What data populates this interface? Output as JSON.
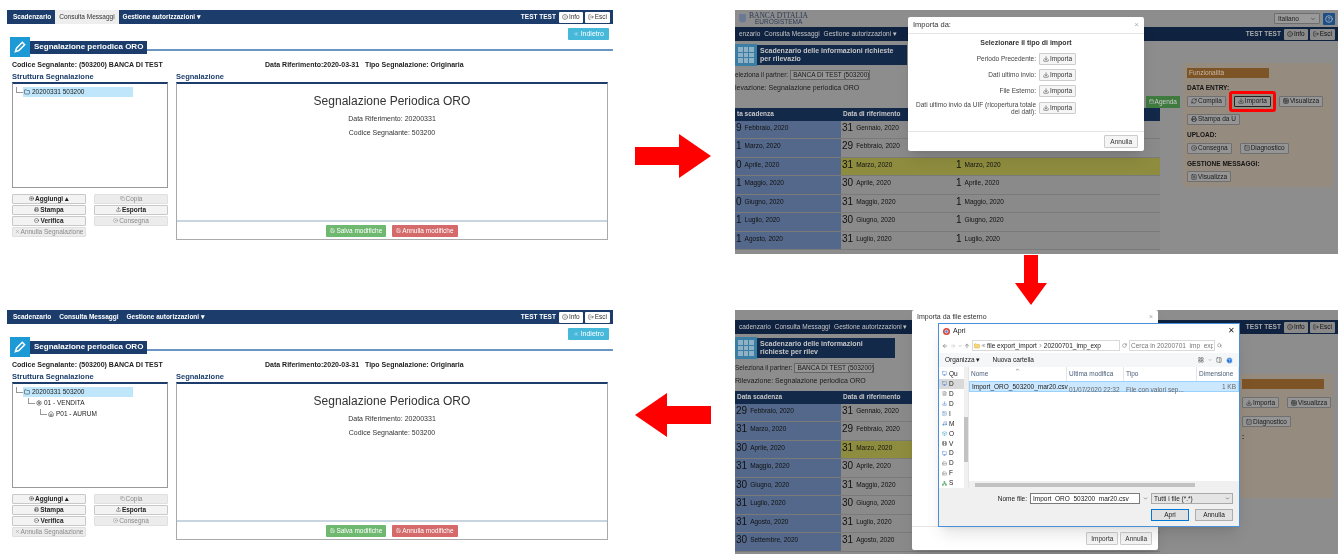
{
  "panels": [
    {
      "kind": "editor",
      "nav": [
        {
          "label": "Scadenzario",
          "selected": false
        },
        {
          "label": "Consulta Messaggi",
          "selected": true
        },
        {
          "label": "Gestione autorizzazioni ▾",
          "selected": false
        }
      ],
      "user": "TEST TEST",
      "info_button": "Info",
      "exit_button": "Esci",
      "back_button": "Indietro",
      "title": "Segnalazione periodica ORO",
      "codice": "Codice Segnalante: (503200) BANCA DI TEST",
      "data_riferimento": "Data Riferimento:2020-03-31",
      "tipo": "Tipo Segnalazione: Originaria",
      "tree_heading": "Struttura Segnalazione",
      "tree": [
        {
          "label": "20200331 503200",
          "selected": true
        }
      ],
      "actions": [
        {
          "label": "Aggiungi ▴",
          "disabled": false
        },
        {
          "label": "Copia",
          "disabled": true
        },
        {
          "label": "Stampa",
          "disabled": false
        },
        {
          "label": "Esporta",
          "disabled": false
        },
        {
          "label": "Verifica",
          "disabled": false
        },
        {
          "label": "Consegna",
          "disabled": true
        },
        {
          "label": "Annulla Segnalazione",
          "disabled": true
        }
      ],
      "section_heading": "Segnalazione",
      "document": {
        "title": "Segnalazione Periodica ORO",
        "lines": [
          "Data Riferimento: 20200331",
          "Codice Segnalante: 503200"
        ]
      },
      "save_button": "Salva modifiche",
      "cancel_button": "Annulla modifiche"
    },
    {
      "kind": "import_choice",
      "logo": {
        "name": "BANCA D'ITALIA",
        "tagline": "EUROSISTEMA"
      },
      "language": "Italiano",
      "nav": [
        {
          "label": "enzario",
          "selected": false
        },
        {
          "label": "Consulta Messaggi",
          "selected": false
        },
        {
          "label": "Gestione autorizzazioni ▾",
          "selected": false
        }
      ],
      "user": "TEST TEST",
      "info_button": "Info",
      "exit_button": "Esci",
      "title": "Scadenzario delle informazioni richieste per rilevazio",
      "partner_label": "eleziona il partner:",
      "partner": "BANCA DI TEST (503200)",
      "rilevazione": "levazione: Segnalazione periodica ORO",
      "agenda_button": "Agenda",
      "columns": [
        "ta scadenza",
        "Data di riferimento"
      ],
      "rows": [
        {
          "selected": false,
          "cells": [
            {
              "day": "9",
              "month": "Febbraio, 2020"
            },
            {
              "day": "31",
              "month": "Gennaio, 2020"
            }
          ]
        },
        {
          "selected": false,
          "cells": [
            {
              "day": "1",
              "month": "Marzo, 2020"
            },
            {
              "day": "29",
              "month": "Febbraio, 2020"
            }
          ]
        },
        {
          "selected": true,
          "cells": [
            {
              "day": "0",
              "month": "Aprile, 2020"
            },
            {
              "day": "31",
              "month": "Marzo, 2020"
            },
            {
              "day": "1",
              "month": "Marzo, 2020"
            }
          ]
        },
        {
          "selected": false,
          "cells": [
            {
              "day": "1",
              "month": "Maggio, 2020"
            },
            {
              "day": "30",
              "month": "Aprile, 2020"
            },
            {
              "day": "1",
              "month": "Aprile, 2020"
            }
          ]
        },
        {
          "selected": false,
          "cells": [
            {
              "day": "0",
              "month": "Giugno, 2020"
            },
            {
              "day": "31",
              "month": "Maggio, 2020"
            },
            {
              "day": "1",
              "month": "Maggio, 2020"
            }
          ]
        },
        {
          "selected": false,
          "cells": [
            {
              "day": "1",
              "month": "Luglio, 2020"
            },
            {
              "day": "30",
              "month": "Giugno, 2020"
            },
            {
              "day": "1",
              "month": "Giugno, 2020"
            }
          ]
        },
        {
          "selected": false,
          "cells": [
            {
              "day": "1",
              "month": "Agosto, 2020"
            },
            {
              "day": "31",
              "month": "Luglio, 2020"
            },
            {
              "day": "1",
              "month": "Luglio, 2020"
            }
          ]
        }
      ],
      "functions": {
        "title": "Funzionalità",
        "groups": [
          {
            "heading": "DATA ENTRY:",
            "buttons": [
              {
                "label": "Compila",
                "kind": "compile",
                "highlighted": false
              },
              {
                "label": "Importa",
                "kind": "import",
                "highlighted": true
              },
              {
                "label": "Visualizza",
                "kind": "view",
                "highlighted": false
              },
              {
                "label": "Stampa da U",
                "kind": "print",
                "highlighted": false
              }
            ]
          },
          {
            "heading": "UPLOAD:",
            "buttons": [
              {
                "label": "Consegna",
                "kind": "deliver",
                "highlighted": false
              },
              {
                "label": "Diagnostico",
                "kind": "diagnose",
                "highlighted": false
              }
            ]
          },
          {
            "heading": "GESTIONE MESSAGGI:",
            "buttons": [
              {
                "label": "Visualizza",
                "kind": "messages",
                "highlighted": false
              }
            ]
          }
        ]
      },
      "dialog": {
        "title": "Importa da:",
        "close": "×",
        "heading": "Selezionare il tipo di import",
        "options": [
          {
            "label": "Periodo Precedente:",
            "button": "Importa"
          },
          {
            "label": "Dati ultimo invio:",
            "button": "Importa"
          },
          {
            "label": "File Esterno:",
            "button": "Importa"
          },
          {
            "label": "Dati ultimo invio da UIF (ricopertura totale dei dati):",
            "button": "Importa"
          }
        ],
        "cancel_button": "Annulla"
      }
    },
    {
      "kind": "editor",
      "nav": [
        {
          "label": "Scadenzario",
          "selected": false
        },
        {
          "label": "Consulta Messaggi",
          "selected": false
        },
        {
          "label": "Gestione autorizzazioni ▾",
          "selected": false
        }
      ],
      "user": "TEST TEST",
      "info_button": "Info",
      "exit_button": "Esci",
      "back_button": "Indietro",
      "title": "Segnalazione periodica ORO",
      "codice": "Codice Segnalante: (503200) BANCA DI TEST",
      "data_riferimento": "Data Riferimento:2020-03-31",
      "tipo": "Tipo Segnalazione: Originaria",
      "tree_heading": "Struttura Segnalazione",
      "tree": [
        {
          "label": "20200331 503200",
          "selected": true,
          "children": [
            {
              "label": "01 - VENDITA",
              "selected": false,
              "children": [
                {
                  "label": "P01 - AURUM",
                  "selected": false
                }
              ]
            }
          ]
        }
      ],
      "actions": [
        {
          "label": "Aggiungi ▴",
          "disabled": false
        },
        {
          "label": "Copia",
          "disabled": true
        },
        {
          "label": "Stampa",
          "disabled": false
        },
        {
          "label": "Esporta",
          "disabled": false
        },
        {
          "label": "Verifica",
          "disabled": false
        },
        {
          "label": "Consegna",
          "disabled": true
        },
        {
          "label": "Annulla Segnalazione",
          "disabled": true
        }
      ],
      "section_heading": "Segnalazione",
      "document": {
        "title": "Segnalazione Periodica ORO",
        "lines": [
          "Data Riferimento: 20200331",
          "Codice Segnalante: 503200"
        ]
      },
      "save_button": "Salva modifiche",
      "cancel_button": "Annulla modifiche"
    },
    {
      "kind": "file_picker",
      "nav": [
        {
          "label": "cadenzario",
          "selected": false
        },
        {
          "label": "Consulta Messaggi",
          "selected": false
        },
        {
          "label": "Gestione autorizzazioni ▾",
          "selected": false
        }
      ],
      "user": "TEST TEST",
      "info_button": "Info",
      "exit_button": "Esci",
      "title": "Scadenzario delle informazioni richieste per rilev",
      "partner_label": "Seleziona il partner:",
      "partner": "BANCA DI TEST (503200)",
      "rilevazione": "Rilevazione: Segnalazione periodica ORO",
      "columns": [
        "Data scadenza",
        "Data di riferimento"
      ],
      "rows": [
        {
          "selected": false,
          "cells": [
            {
              "day": "29",
              "month": "Febbraio, 2020"
            },
            {
              "day": "31",
              "month": "Gennaio, 2020"
            }
          ]
        },
        {
          "selected": false,
          "cells": [
            {
              "day": "31",
              "month": "Marzo, 2020"
            },
            {
              "day": "29",
              "month": "Febbraio, 2020"
            }
          ]
        },
        {
          "selected": true,
          "cells": [
            {
              "day": "30",
              "month": "Aprile, 2020"
            },
            {
              "day": "31",
              "month": "Marzo, 2020"
            }
          ]
        },
        {
          "selected": false,
          "cells": [
            {
              "day": "31",
              "month": "Maggio, 2020"
            },
            {
              "day": "30",
              "month": "Aprile, 2020"
            }
          ]
        },
        {
          "selected": false,
          "cells": [
            {
              "day": "30",
              "month": "Giugno, 2020"
            },
            {
              "day": "31",
              "month": "Maggio, 2020"
            }
          ]
        },
        {
          "selected": false,
          "cells": [
            {
              "day": "31",
              "month": "Luglio, 2020"
            },
            {
              "day": "30",
              "month": "Giugno, 2020"
            }
          ]
        },
        {
          "selected": false,
          "cells": [
            {
              "day": "31",
              "month": "Agosto, 2020"
            },
            {
              "day": "31",
              "month": "Luglio, 2020"
            }
          ]
        },
        {
          "selected": false,
          "cells": [
            {
              "day": "30",
              "month": "Settembre, 2020"
            },
            {
              "day": "31",
              "month": "Agosto, 2020"
            }
          ]
        }
      ],
      "functions": {
        "groups": [
          {
            "buttons": [
              {
                "label": "Importa",
                "kind": "import",
                "highlighted": false
              },
              {
                "label": "Visualizza",
                "kind": "view",
                "highlighted": false
              }
            ]
          },
          {
            "buttons": [
              {
                "label": "Diagnostico",
                "kind": "diagnose",
                "highlighted": false
              }
            ]
          },
          {
            "heading": ":"
          }
        ]
      },
      "back_dialog": {
        "title": "Importa da file esterno",
        "close": "×",
        "buttons": [
          "Importa",
          "Annulla"
        ]
      },
      "file_dialog": {
        "title": "Apri",
        "close": "✕",
        "path": [
          "file export_import",
          "20200701_imp_exp"
        ],
        "search_placeholder": "Cerca in 20200701_imp_exp",
        "toolbar": [
          "Organizza ▾",
          "Nuova cartella"
        ],
        "places": [
          {
            "label": "Qu",
            "selected": false
          },
          {
            "label": "D",
            "selected": true
          },
          {
            "label": "D",
            "selected": false
          },
          {
            "label": "D",
            "selected": false
          },
          {
            "label": "I",
            "selected": false
          },
          {
            "label": "M",
            "selected": false
          },
          {
            "label": "O",
            "selected": false
          },
          {
            "label": "V",
            "selected": false
          },
          {
            "label": "D",
            "selected": false
          },
          {
            "label": "D",
            "selected": false
          },
          {
            "label": "F",
            "selected": false
          },
          {
            "label": "S",
            "selected": false
          }
        ],
        "columns": [
          "Nome",
          "Ultima modifica",
          "Tipo",
          "Dimensione"
        ],
        "files": [
          {
            "name": "Import_ORO_503200_mar20.csv",
            "modified": "01/07/2020 22:32",
            "type": "File con valori sep...",
            "size": "1 KB",
            "selected": true
          }
        ],
        "filename_label": "Nome file:",
        "filename": "Import_ORO_503200_mar20.csv",
        "filter": "Tutti i file (*.*)",
        "open_button": "Apri",
        "cancel_button": "Annulla"
      }
    }
  ]
}
